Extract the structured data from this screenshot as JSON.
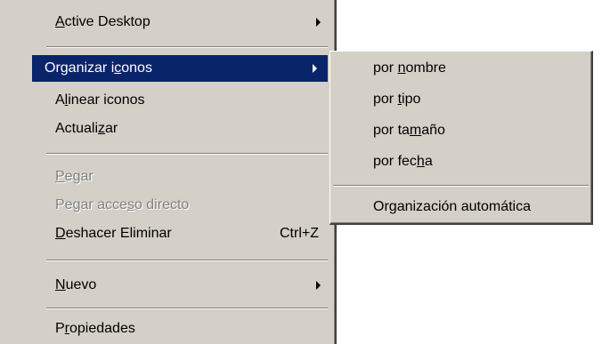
{
  "main_menu": {
    "items": [
      {
        "pre": "",
        "acc": "A",
        "post": "ctive Desktop",
        "submenu": true
      },
      {
        "pre": "Organizar i",
        "acc": "c",
        "post": "onos",
        "submenu": true,
        "highlighted": true
      },
      {
        "pre": "A",
        "acc": "l",
        "post": "inear iconos"
      },
      {
        "pre": "Actuali",
        "acc": "z",
        "post": "ar"
      },
      {
        "pre": "",
        "acc": "P",
        "post": "egar",
        "disabled": true
      },
      {
        "pre": "Pegar acce",
        "acc": "s",
        "post": "o directo",
        "disabled": true
      },
      {
        "pre": "",
        "acc": "D",
        "post": "eshacer Eliminar",
        "shortcut": "Ctrl+Z"
      },
      {
        "pre": "",
        "acc": "N",
        "post": "uevo",
        "submenu": true
      },
      {
        "pre": "P",
        "acc": "r",
        "post": "opiedades"
      }
    ]
  },
  "sub_menu": {
    "items": [
      {
        "pre": "por ",
        "acc": "n",
        "post": "ombre"
      },
      {
        "pre": "por ",
        "acc": "t",
        "post": "ipo"
      },
      {
        "pre": "por ta",
        "acc": "m",
        "post": "año"
      },
      {
        "pre": "por fec",
        "acc": "h",
        "post": "a"
      },
      {
        "pre": "Or",
        "acc": "g",
        "post": "anización automática"
      }
    ]
  },
  "colors": {
    "menu_bg": "#d4d0c8",
    "highlight_bg": "#0a246a",
    "highlight_text": "#ffffff",
    "disabled_text": "#808080"
  },
  "icons": {
    "submenu_arrow": "chevron-right-icon"
  }
}
